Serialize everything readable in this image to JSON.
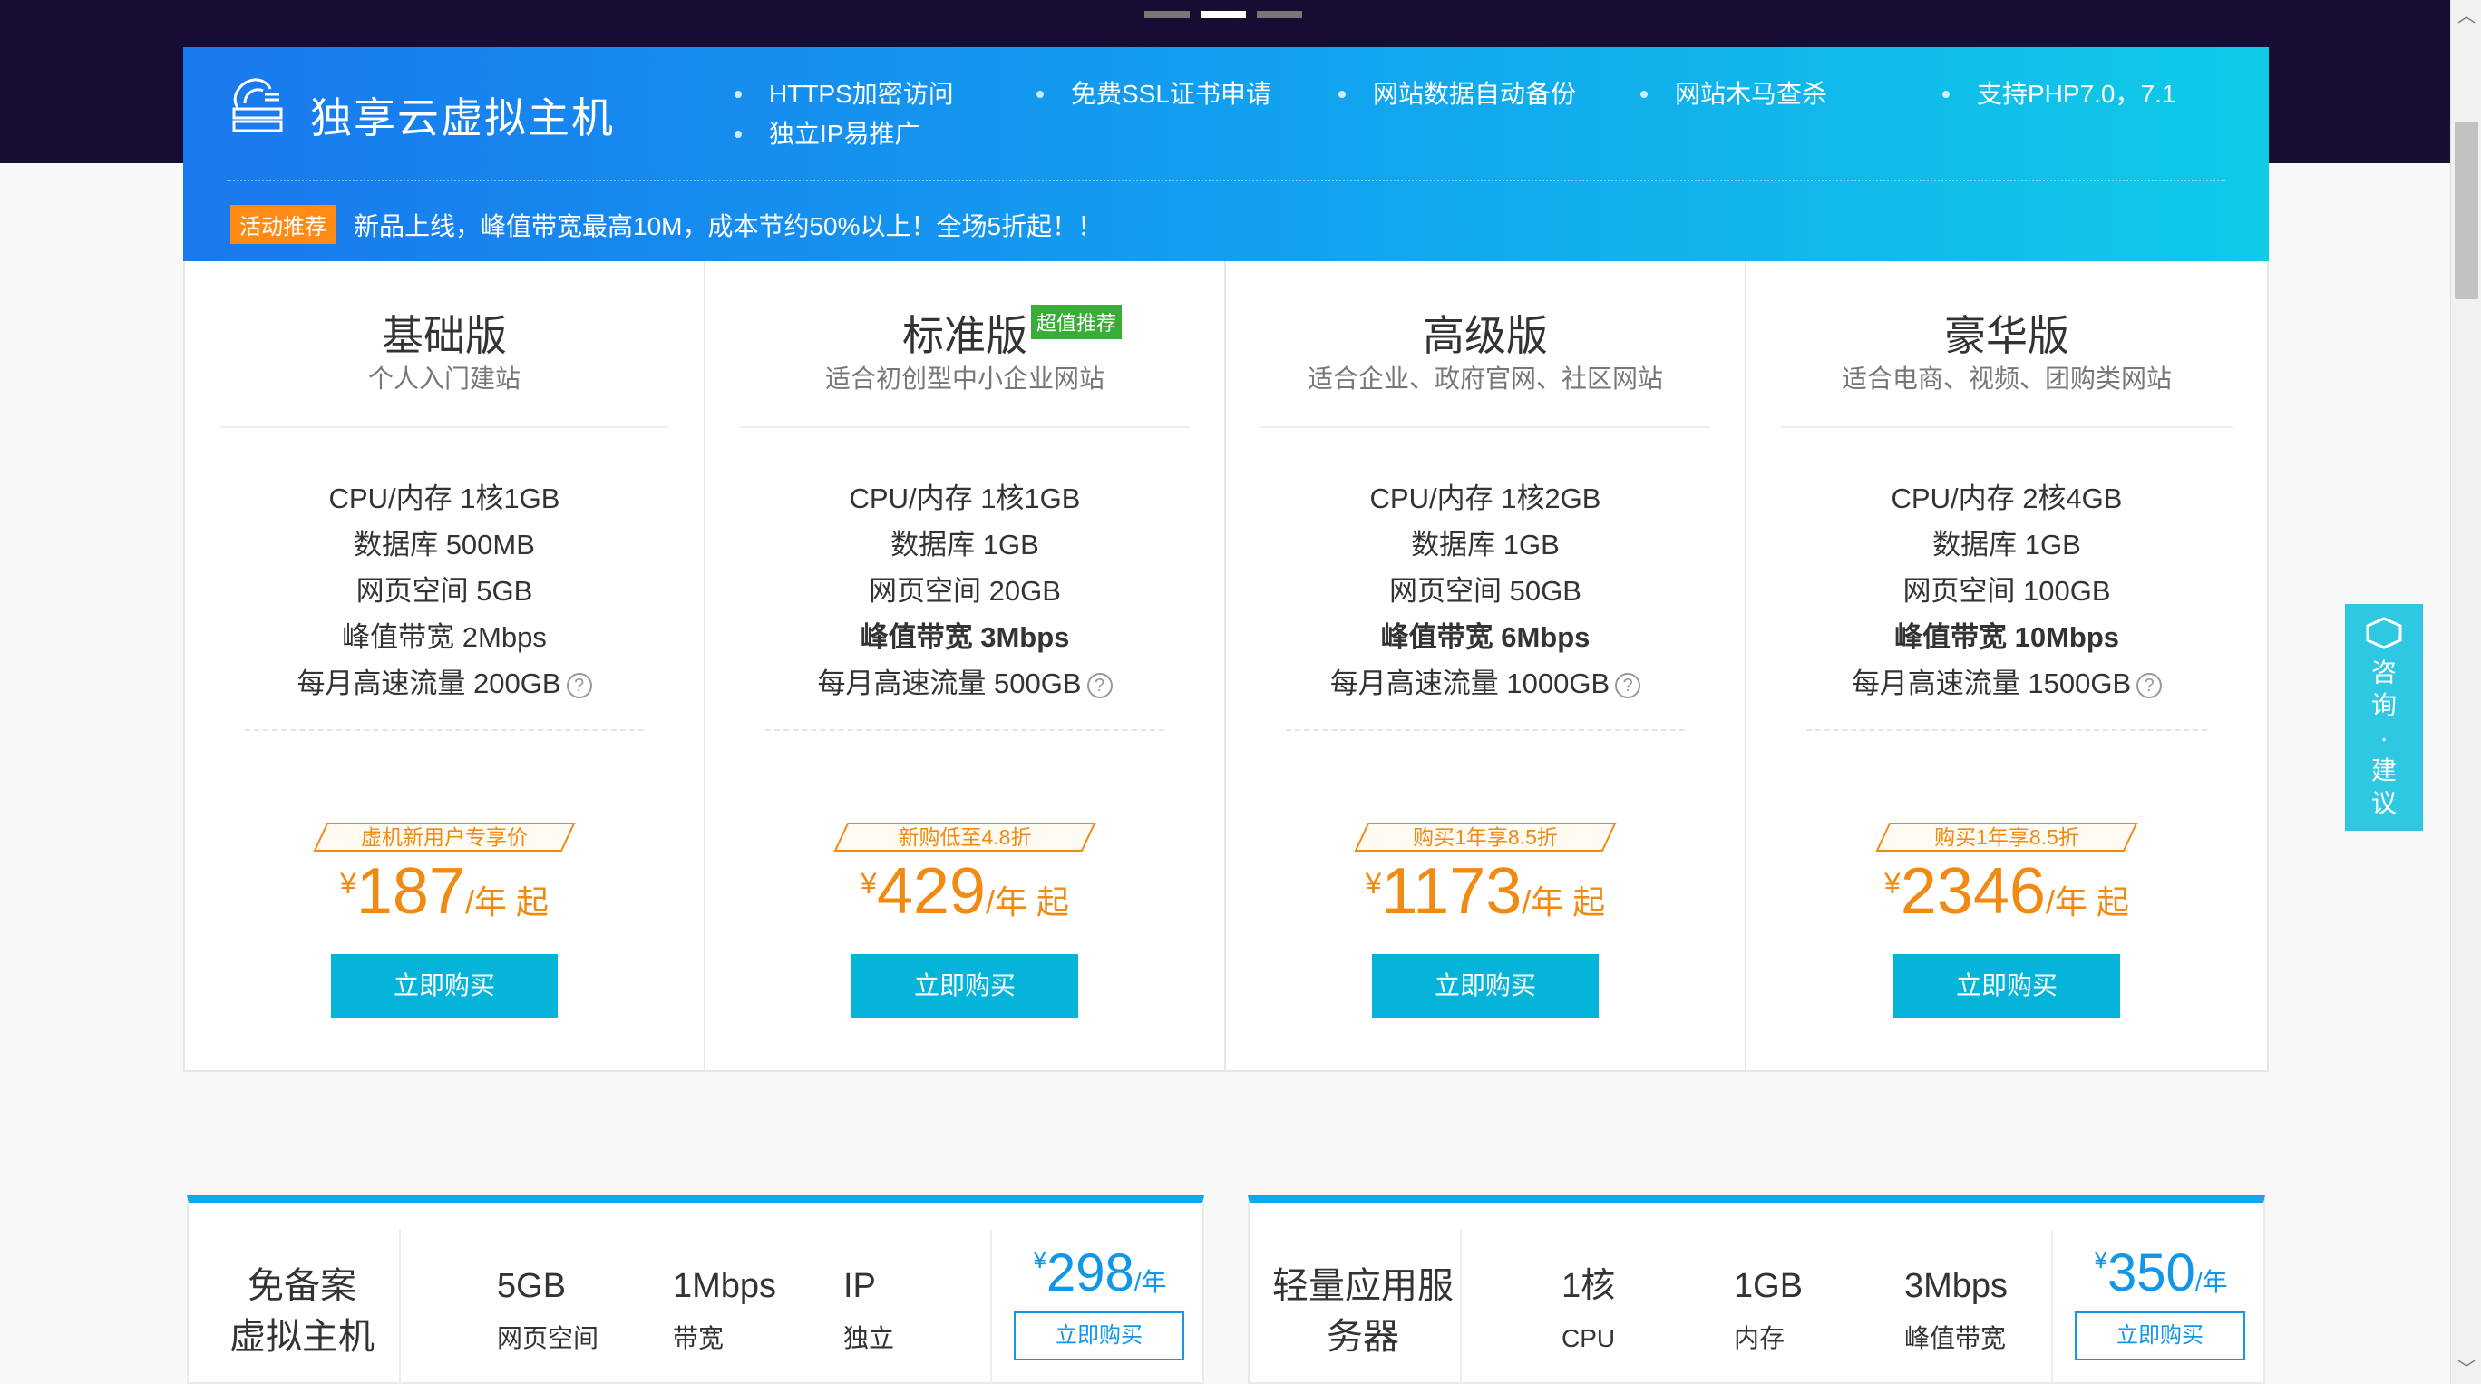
{
  "banner": {
    "title": "独享云虚拟主机",
    "features": [
      "HTTPS加密访问",
      "免费SSL证书申请",
      "网站数据自动备份",
      "网站木马查杀",
      "支持PHP7.0，7.1",
      "独立IP易推广"
    ],
    "promo_badge": "活动推荐",
    "promo_text": "新品上线，峰值带宽最高10M，成本节约50%以上！全场5折起！！"
  },
  "plans": [
    {
      "name": "基础版",
      "tag": "",
      "desc": "个人入门建站",
      "specs": [
        "CPU/内存 1核1GB",
        "数据库 500MB",
        "网页空间 5GB",
        "峰值带宽 2Mbps",
        "每月高速流量 200GB"
      ],
      "ribbon": "虚机新用户专享价",
      "currency": "¥",
      "price": "187",
      "unit": "/年 起",
      "button": "立即购买"
    },
    {
      "name": "标准版",
      "tag": "超值推荐",
      "desc": "适合初创型中小企业网站",
      "specs": [
        "CPU/内存 1核1GB",
        "数据库 1GB",
        "网页空间 20GB",
        "峰值带宽 3Mbps",
        "每月高速流量 500GB"
      ],
      "ribbon": "新购低至4.8折",
      "currency": "¥",
      "price": "429",
      "unit": "/年 起",
      "button": "立即购买"
    },
    {
      "name": "高级版",
      "tag": "",
      "desc": "适合企业、政府官网、社区网站",
      "specs": [
        "CPU/内存 1核2GB",
        "数据库 1GB",
        "网页空间 50GB",
        "峰值带宽 6Mbps",
        "每月高速流量 1000GB"
      ],
      "ribbon": "购买1年享8.5折",
      "currency": "¥",
      "price": "1173",
      "unit": "/年 起",
      "button": "立即购买"
    },
    {
      "name": "豪华版",
      "tag": "",
      "desc": "适合电商、视频、团购类网站",
      "specs": [
        "CPU/内存 2核4GB",
        "数据库 1GB",
        "网页空间 100GB",
        "峰值带宽 10Mbps",
        "每月高速流量 1500GB"
      ],
      "ribbon": "购买1年享8.5折",
      "currency": "¥",
      "price": "2346",
      "unit": "/年 起",
      "button": "立即购买"
    }
  ],
  "help_glyph": "?",
  "consult": {
    "chars": [
      "咨",
      "询",
      "·",
      "建",
      "议"
    ]
  },
  "products": [
    {
      "name_line1": "免备案",
      "name_line2": "虚拟主机",
      "specs": [
        {
          "value": "5GB",
          "label": "网页空间"
        },
        {
          "value": "1Mbps",
          "label": "带宽"
        },
        {
          "value": "IP",
          "label": "独立"
        }
      ],
      "currency": "¥",
      "price": "298",
      "unit": "/年",
      "button": "立即购买"
    },
    {
      "name_line1": "轻量应用服",
      "name_line2": "务器",
      "specs": [
        {
          "value": "1核",
          "label": "CPU"
        },
        {
          "value": "1GB",
          "label": "内存"
        },
        {
          "value": "3Mbps",
          "label": "峰值带宽"
        }
      ],
      "currency": "¥",
      "price": "350",
      "unit": "/年",
      "button": "立即购买"
    }
  ],
  "scrollbar": {
    "up_glyph": "︿",
    "down_glyph": "﹀"
  },
  "colors": {
    "accent": "#06b4d9",
    "price": "#f08a12",
    "banner_start": "#1a78ee",
    "banner_end": "#0fcbe7",
    "tag_green": "#3aac38",
    "promo_orange": "#ff8b16",
    "dark_bg": "#170d33"
  }
}
